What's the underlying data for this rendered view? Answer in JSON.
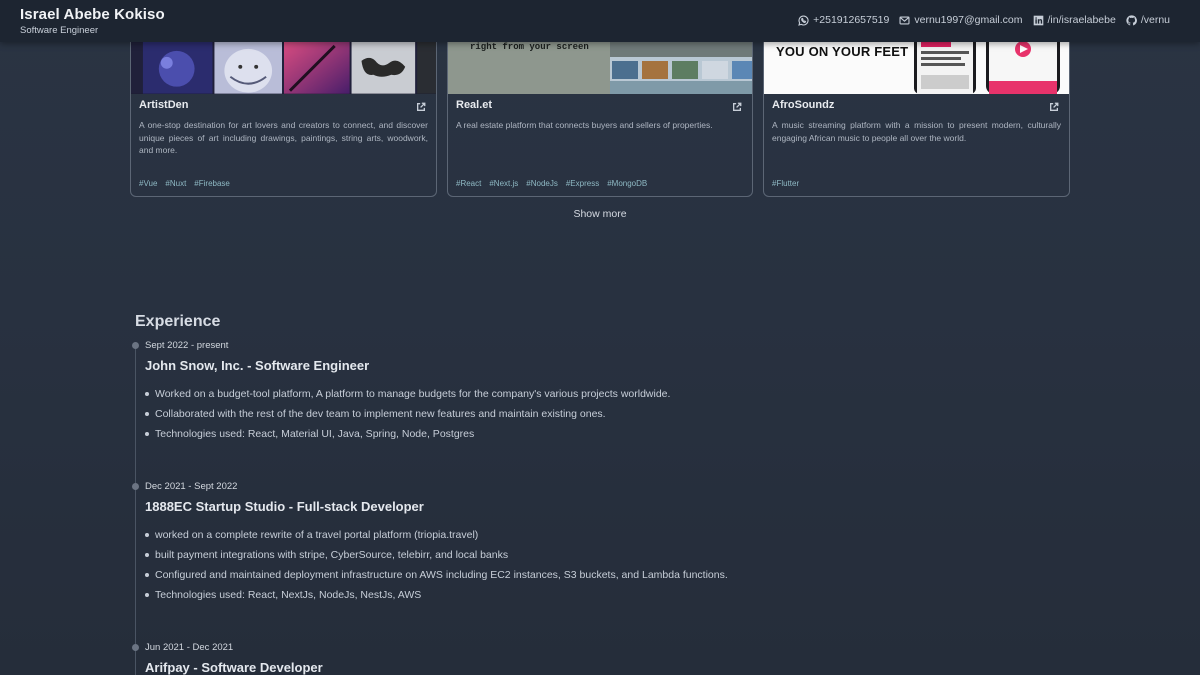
{
  "header": {
    "name": "Israel Abebe Kokiso",
    "subtitle": "Software Engineer",
    "contacts": [
      {
        "icon": "whatsapp-icon",
        "text": "+251912657519"
      },
      {
        "icon": "mail-icon",
        "text": "vernu1997@gmail.com"
      },
      {
        "icon": "linkedin-icon",
        "text": "/in/israelabebe"
      },
      {
        "icon": "github-icon",
        "text": "/vernu"
      }
    ]
  },
  "projects": [
    {
      "title": "ArtistDen",
      "description": "A one-stop destination for art lovers and creators to connect, and discover unique pieces of art including drawings, paintings, string arts, woodwork, and more.",
      "tags": [
        "#Vue",
        "#Nuxt",
        "#Firebase"
      ]
    },
    {
      "title": "Real.et",
      "thumb_text": "right from your screen",
      "description": "A real estate platform that connects buyers and sellers of properties.",
      "tags": [
        "#React",
        "#Next.js",
        "#NodeJs",
        "#Express",
        "#MongoDB"
      ]
    },
    {
      "title": "AfroSoundz",
      "thumb_text": "YOU ON YOUR FEET",
      "description": "A music streaming platform with a mission to present modern, culturally engaging African music to people all over the world.",
      "tags": [
        "#Flutter"
      ]
    }
  ],
  "show_more_label": "Show more",
  "experience": {
    "title": "Experience",
    "jobs": [
      {
        "date": "Sept 2022 - present",
        "role": "John Snow, Inc. - Software Engineer",
        "points": [
          "Worked on a budget-tool platform, A platform to manage budgets for the company's various projects worldwide.",
          "Collaborated with the rest of the dev team to implement new features and maintain existing ones.",
          "Technologies used: React, Material UI, Java, Spring, Node, Postgres"
        ]
      },
      {
        "date": "Dec 2021 - Sept 2022",
        "role": "1888EC Startup Studio - Full-stack Developer",
        "points": [
          "worked on a complete rewrite of a travel portal platform (triopia.travel)",
          "built payment integrations with stripe, CyberSource, telebirr, and local banks",
          "Configured and maintained deployment infrastructure on AWS including EC2 instances, S3 buckets, and Lambda functions.",
          "Technologies used: React, NextJs, NodeJs, NestJs, AWS"
        ]
      },
      {
        "date": "Jun 2021 - Dec 2021",
        "role": "Arifpay - Software Developer",
        "points": []
      }
    ]
  }
}
